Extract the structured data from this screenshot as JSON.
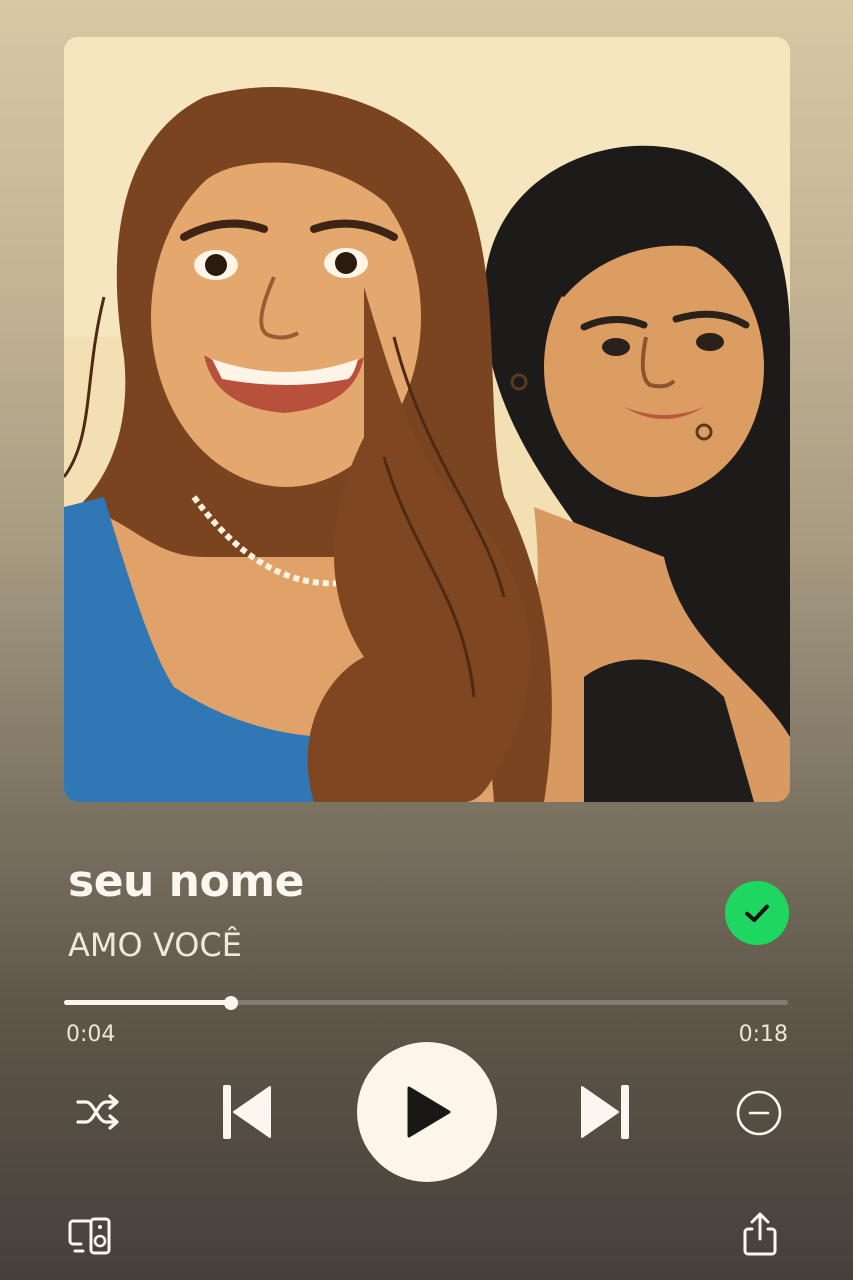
{
  "album_art": {
    "description_icon": "album-artwork-illustration"
  },
  "track": {
    "title": "seu nome",
    "artist": "AMO VOCÊ",
    "liked": true
  },
  "playback": {
    "elapsed": "0:04",
    "total": "0:18",
    "progress_fraction": 0.23,
    "is_playing": false
  },
  "controls": {
    "shuffle_icon": "shuffle-icon",
    "previous_icon": "skip-previous-icon",
    "play_icon": "play-icon",
    "next_icon": "skip-next-icon",
    "remove_icon": "minus-circle-icon",
    "devices_icon": "connect-devices-icon",
    "share_icon": "share-icon"
  },
  "colors": {
    "accent_green": "#1ed760",
    "foreground": "#fbf7ef"
  }
}
